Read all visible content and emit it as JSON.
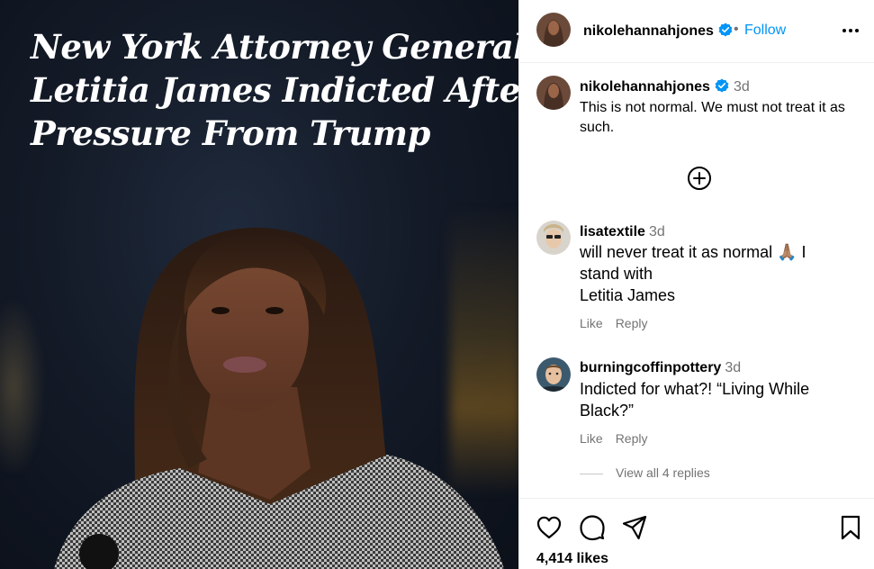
{
  "media": {
    "headline_lines": [
      "New York Attorney General",
      "Letitia James Indicted After",
      "Pressure From Trump"
    ]
  },
  "header": {
    "username": "nikolehannahjones",
    "separator": "•",
    "follow_label": "Follow",
    "more_icon": "more-horizontal-icon",
    "verified_icon": "verified-badge-icon"
  },
  "caption": {
    "username": "nikolehannahjones",
    "time": "3d",
    "text": "This is not normal. We must not treat it as such."
  },
  "add_comment_icon": "plus-circle-icon",
  "comments": [
    {
      "username": "lisatextile",
      "time": "3d",
      "lines": [
        "will never treat it as normal 🙏🏽 I",
        "stand with",
        "Letitia James"
      ],
      "like_label": "Like",
      "reply_label": "Reply"
    },
    {
      "username": "burningcoffinpottery",
      "time": "3d",
      "lines": [
        "Indicted for what?! “Living While",
        "Black?”"
      ],
      "like_label": "Like",
      "reply_label": "Reply"
    }
  ],
  "view_replies_label": "View all 4 replies",
  "actions": {
    "icons": [
      "heart-icon",
      "comment-icon",
      "share-icon",
      "bookmark-icon"
    ]
  },
  "likes_label": "4,414 likes",
  "colors": {
    "accent": "#0095f6",
    "muted": "#737373",
    "verified": "#0095f6"
  }
}
